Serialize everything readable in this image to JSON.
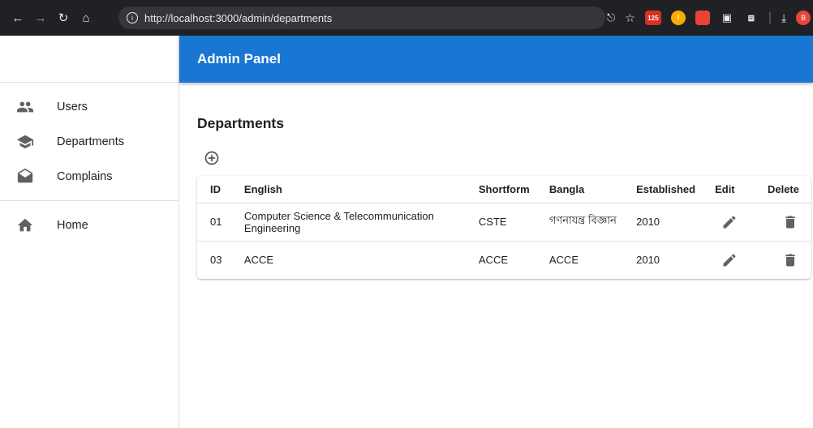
{
  "browser": {
    "url": "http://localhost:3000/admin/departments",
    "badge_count": "125",
    "profile_initial": "B"
  },
  "app": {
    "title": "Admin Panel",
    "accent": "#1976d2"
  },
  "sidebar": {
    "items": [
      {
        "label": "Users",
        "icon": "people-icon"
      },
      {
        "label": "Departments",
        "icon": "school-icon"
      },
      {
        "label": "Complains",
        "icon": "drafts-icon"
      }
    ],
    "secondary": [
      {
        "label": "Home",
        "icon": "home-icon"
      }
    ]
  },
  "page": {
    "heading": "Departments"
  },
  "table": {
    "headers": {
      "id": "ID",
      "english": "English",
      "shortform": "Shortform",
      "bangla": "Bangla",
      "established": "Established",
      "edit": "Edit",
      "delete": "Delete"
    },
    "rows": [
      {
        "id": "01",
        "english": "Computer Science & Telecommunication Engineering",
        "shortform": "CSTE",
        "bangla": "গণনাযন্ত্র বিজ্ঞান",
        "established": "2010"
      },
      {
        "id": "03",
        "english": "ACCE",
        "shortform": "ACCE",
        "bangla": "ACCE",
        "established": "2010"
      }
    ]
  }
}
